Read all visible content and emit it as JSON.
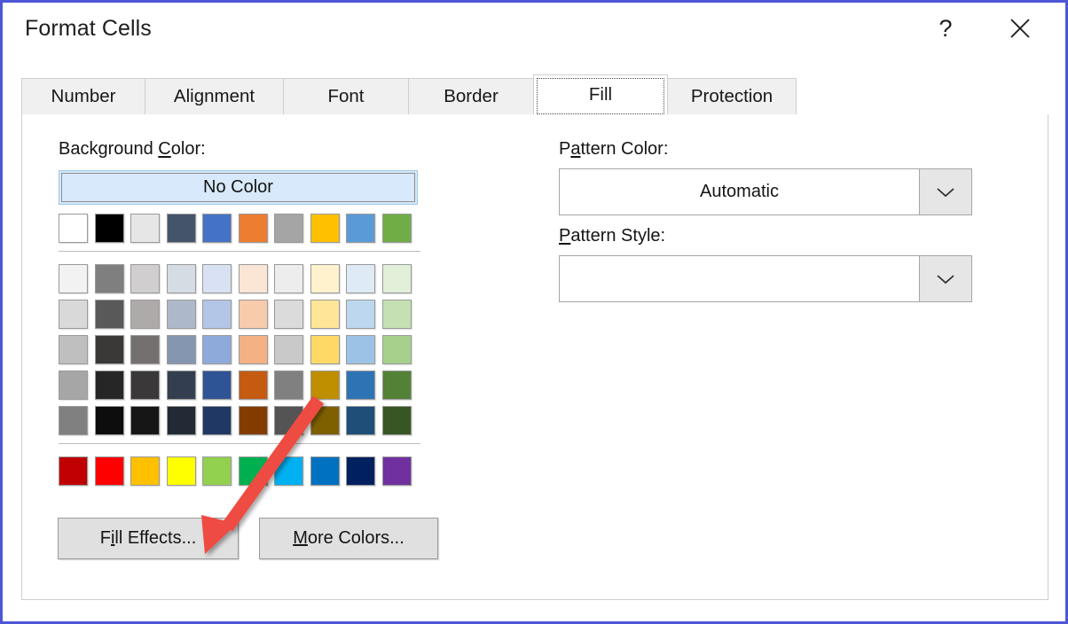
{
  "window": {
    "title": "Format Cells",
    "help_label": "?",
    "close_label": "✕",
    "border_color": "#4d57d6"
  },
  "tabs": [
    {
      "id": "number",
      "label": "Number",
      "selected": false
    },
    {
      "id": "alignment",
      "label": "Alignment",
      "selected": false
    },
    {
      "id": "font",
      "label": "Font",
      "selected": false
    },
    {
      "id": "border",
      "label": "Border",
      "selected": false
    },
    {
      "id": "fill",
      "label": "Fill",
      "selected": true
    },
    {
      "id": "protection",
      "label": "Protection",
      "selected": false
    }
  ],
  "background_color": {
    "label_prefix": "Background ",
    "label_accesskey": "C",
    "label_suffix": "olor:",
    "no_color_label": "No Color",
    "no_color_selected": true,
    "theme_colors": [
      "#FFFFFF",
      "#000000",
      "#E7E6E6",
      "#44546A",
      "#4472C4",
      "#ED7D31",
      "#A5A5A5",
      "#FFC000",
      "#5B9BD5",
      "#70AD47"
    ],
    "theme_variants": [
      [
        "#F2F2F2",
        "#7F7F7F",
        "#D0CECE",
        "#D6DCE4",
        "#D9E2F3",
        "#FBE5D5",
        "#EDEDED",
        "#FFF2CC",
        "#DEEBF6",
        "#E2EFD9"
      ],
      [
        "#D9D9D9",
        "#595959",
        "#AEAAAA",
        "#ADB9CA",
        "#B4C6E7",
        "#F7CBAC",
        "#DBDBDB",
        "#FFE598",
        "#BDD7EE",
        "#C5E0B3"
      ],
      [
        "#BFBFBF",
        "#3B3838",
        "#757070",
        "#8496B0",
        "#8EAADB",
        "#F4B183",
        "#C9C9C9",
        "#FFD965",
        "#9CC3E5",
        "#A8D08D"
      ],
      [
        "#A6A6A6",
        "#262626",
        "#3A3838",
        "#333F4F",
        "#2F5496",
        "#C55A11",
        "#808080",
        "#BF8F00",
        "#2E74B5",
        "#538135"
      ],
      [
        "#808080",
        "#0D0D0D",
        "#171616",
        "#222A35",
        "#1F3864",
        "#833C00",
        "#545454",
        "#7F6000",
        "#1F4E79",
        "#375623"
      ]
    ],
    "standard_colors": [
      "#C00000",
      "#FF0000",
      "#FFC000",
      "#FFFF00",
      "#92D050",
      "#00B050",
      "#00B0F0",
      "#0070C0",
      "#002060",
      "#7030A0"
    ]
  },
  "buttons": {
    "fill_effects": {
      "prefix": "F",
      "accesskey": "i",
      "suffix": "ll Effects..."
    },
    "more_colors": {
      "prefix": "",
      "accesskey": "M",
      "suffix": "ore Colors..."
    }
  },
  "pattern_color": {
    "label_prefix": "P",
    "label_accesskey": "a",
    "label_suffix": "ttern Color:",
    "value": "Automatic"
  },
  "pattern_style": {
    "label_prefix": "",
    "label_accesskey": "P",
    "label_suffix": "attern Style:",
    "value": ""
  },
  "annotation": {
    "arrow_color": "#EE4B43",
    "points_to": "Fill Effects..."
  }
}
